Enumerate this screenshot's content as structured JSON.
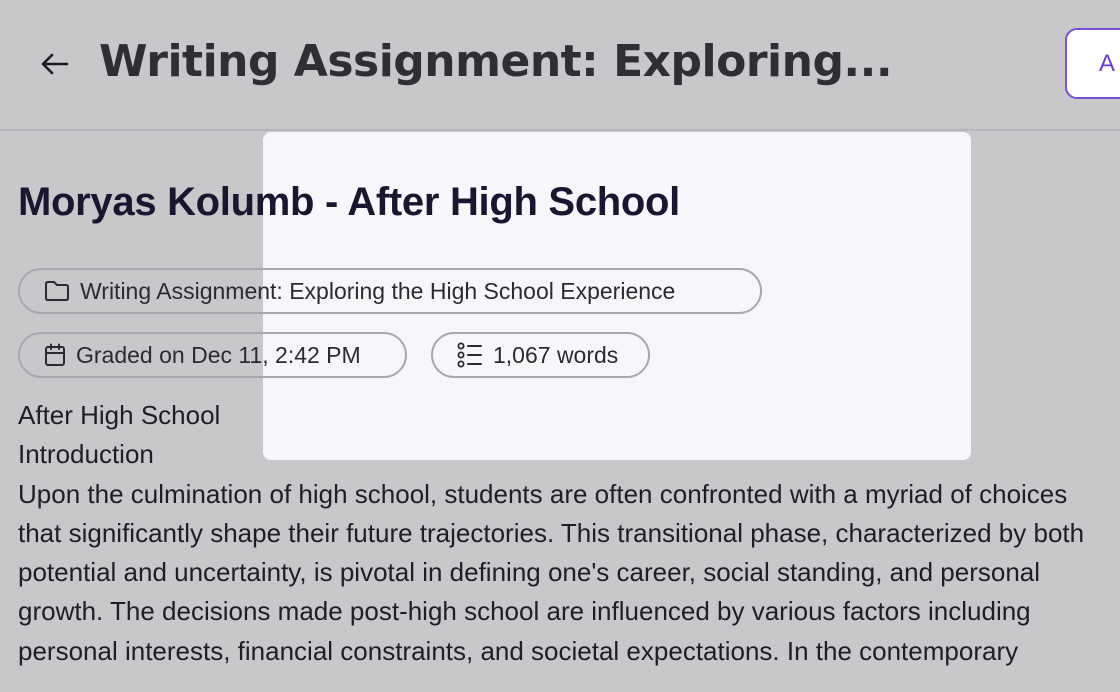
{
  "header": {
    "title": "Writing Assignment: Exploring...",
    "action_label": "A"
  },
  "document": {
    "title": "Moryas Kolumb - After High School",
    "assignment_chip": "Writing Assignment: Exploring the High School Experience",
    "graded_chip": "Graded on Dec 11, 2:42 PM",
    "word_count_chip": "1,067 words"
  },
  "essay": {
    "heading": "After High School",
    "section": "Introduction",
    "paragraph": "Upon the culmination of high school, students are often confronted with a myriad of choices that significantly shape their future trajectories. This transitional phase, characterized by both potential and uncertainty, is pivotal in defining one's career, social standing, and personal growth. The decisions made post-high school are influenced by various factors including personal interests, financial constraints, and societal expectations. In the contemporary"
  },
  "icons": {
    "back": "arrow-left-icon",
    "assignment": "folder-icon",
    "graded": "calendar-icon",
    "words": "list-icon"
  },
  "colors": {
    "accent": "#6b3fd0",
    "background": "#c8c8cb",
    "overlay": "#f6f7fb"
  }
}
